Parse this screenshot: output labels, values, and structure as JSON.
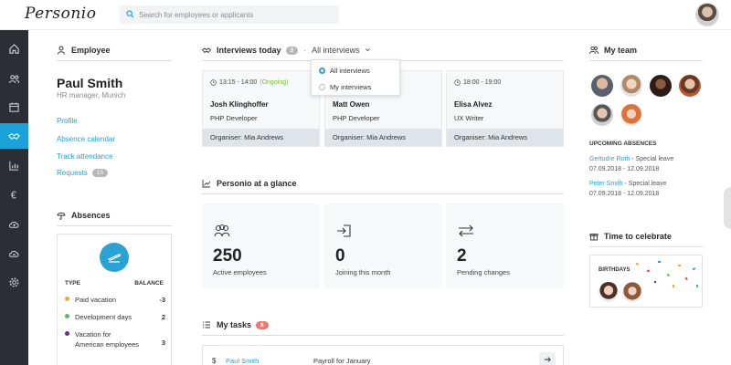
{
  "app": {
    "logo_text": "Personio"
  },
  "search": {
    "placeholder": "Search for employees or applicants"
  },
  "nav": {
    "items": [
      "home-icon",
      "people-icon",
      "calendar-icon",
      "handshake-icon",
      "chart-icon",
      "euro-icon",
      "cloud-upload-icon",
      "cloud-sync-icon",
      "gear-icon"
    ],
    "active": 3
  },
  "employee": {
    "section_title": "Employee",
    "name": "Paul Smith",
    "role": "HR manager, Munich",
    "links": [
      "Profile",
      "Absence calendar",
      "Track attendance",
      "Requests"
    ],
    "requests_count": "15"
  },
  "absences": {
    "section_title": "Absences",
    "col_type": "TYPE",
    "col_balance": "BALANCE",
    "rows": [
      {
        "label": "Paid vacation",
        "value": "-3",
        "color": "#f0a33b"
      },
      {
        "label": "Development days",
        "value": "2",
        "color": "#58b866"
      },
      {
        "label_line1": "Vacation for",
        "label_line2": "American employees",
        "value": "3",
        "color": "#6a2f86"
      }
    ]
  },
  "interviews": {
    "section_title": "Interviews today",
    "count": "3",
    "separator": "·",
    "filter_label": "All interviews",
    "dropdown": [
      "All interviews",
      "My interviews"
    ],
    "cards": [
      {
        "time": "13:15 - 14:00",
        "status": "(Ongoing)",
        "name": "Josh Klinghoffer",
        "role": "PHP Developer",
        "organiser": "Organiser: Mia Andrews"
      },
      {
        "time": "",
        "status": "",
        "name": "Matt Owen",
        "role": "PHP Developer",
        "organiser": "Organiser: Mia Andrews"
      },
      {
        "time": "18:00 - 19:00",
        "status": "",
        "name": "Elisa Alvez",
        "role": "UX Writer",
        "organiser": "Organiser: Mia Andrews"
      }
    ]
  },
  "glance": {
    "section_title": "Personio at a glance",
    "cards": [
      {
        "number": "250",
        "label": "Active employees"
      },
      {
        "number": "0",
        "label": "Joining this month"
      },
      {
        "number": "2",
        "label": "Pending changes"
      }
    ]
  },
  "tasks": {
    "section_title": "My tasks",
    "count": "8",
    "row": {
      "currency": "$",
      "person": "Paul Smith",
      "title": "Payroll for January"
    }
  },
  "team": {
    "section_title": "My team",
    "upcoming_title": "UPCOMING ABSENCES",
    "upcoming": [
      {
        "name": "Gertudre Roth",
        "type": " - Special leave",
        "dates": "07.09.2018 - 12.09.2018"
      },
      {
        "name": "Peter Smith",
        "type": " - Special leave",
        "dates": "07.09.2018 - 12.09.2018"
      }
    ]
  },
  "celebrate": {
    "section_title": "Time to celebrate",
    "banner": "BIRTHDAYS"
  },
  "colors": {
    "accent": "#1ba3d9",
    "sidebar": "#2b2f33",
    "ongoing": "#7bbf3a",
    "link": "#2a9fd0"
  }
}
